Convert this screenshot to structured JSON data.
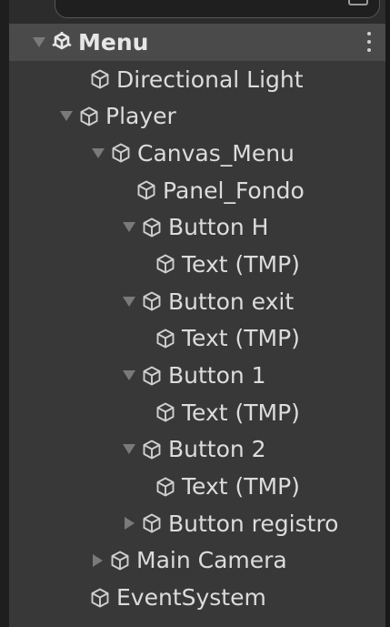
{
  "search": {
    "text": ""
  },
  "scene": {
    "name": "Menu"
  },
  "items": [
    {
      "label": "Directional Light",
      "expand": "none"
    },
    {
      "label": "Player",
      "expand": "down"
    },
    {
      "label": "Canvas_Menu",
      "expand": "down"
    },
    {
      "label": "Panel_Fondo",
      "expand": "none"
    },
    {
      "label": "Button H",
      "expand": "down"
    },
    {
      "label": "Text (TMP)",
      "expand": "none"
    },
    {
      "label": "Button exit",
      "expand": "down"
    },
    {
      "label": "Text (TMP)",
      "expand": "none"
    },
    {
      "label": "Button 1",
      "expand": "down"
    },
    {
      "label": "Text (TMP)",
      "expand": "none"
    },
    {
      "label": "Button 2",
      "expand": "down"
    },
    {
      "label": "Text (TMP)",
      "expand": "none"
    },
    {
      "label": "Button registro",
      "expand": "right"
    },
    {
      "label": "Main Camera",
      "expand": "right"
    },
    {
      "label": "EventSystem",
      "expand": "none"
    }
  ],
  "icons": {
    "scene": "unity-scene-icon",
    "gameobject": "gameobject-cube-icon",
    "menu": "kebab-menu-icon",
    "search": "search-field"
  },
  "colors": {
    "panel": "#383838",
    "scene_row": "#4a4a4a",
    "text": "#dcdcdc"
  }
}
